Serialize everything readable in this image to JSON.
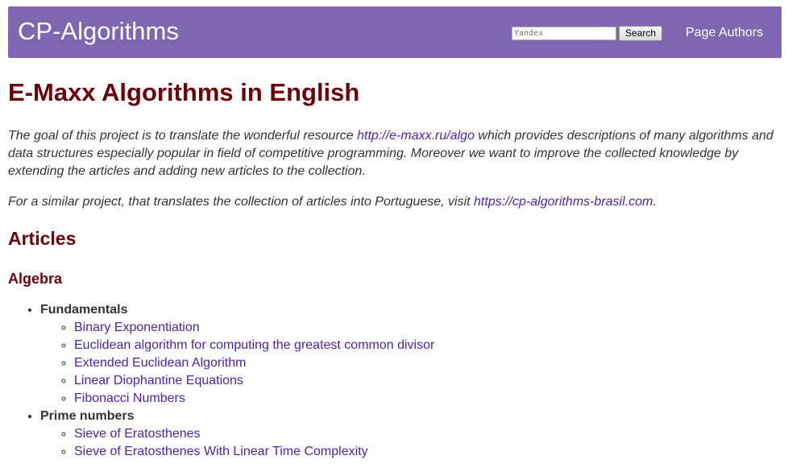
{
  "header": {
    "brand": "CP-Algorithms",
    "search_placeholder": "Yandex",
    "search_button": "Search",
    "page_authors": "Page Authors"
  },
  "main": {
    "title": "E-Maxx Algorithms in English",
    "intro1": {
      "before": "The goal of this project is to translate the wonderful resource ",
      "link": "http://e-maxx.ru/algo",
      "after": " which provides descriptions of many algorithms and data structures especially popular in field of competitive programming. Moreover we want to improve the collected knowledge by extending the articles and adding new articles to the collection."
    },
    "intro2": {
      "before": "For a similar project, that translates the collection of articles into Portuguese, visit ",
      "link": "https://cp-algorithms-brasil.com",
      "after": "."
    },
    "articles_heading": "Articles",
    "section_heading": "Algebra",
    "topics": [
      {
        "label": "Fundamentals",
        "items": [
          "Binary Exponentiation",
          "Euclidean algorithm for computing the greatest common divisor",
          "Extended Euclidean Algorithm",
          "Linear Diophantine Equations",
          "Fibonacci Numbers"
        ]
      },
      {
        "label": "Prime numbers",
        "items": [
          "Sieve of Eratosthenes",
          "Sieve of Eratosthenes With Linear Time Complexity"
        ]
      }
    ]
  },
  "colors": {
    "navbar": "#7e67b0",
    "heading": "#6d0008",
    "link": "#4b1fb0",
    "text": "#333333"
  }
}
